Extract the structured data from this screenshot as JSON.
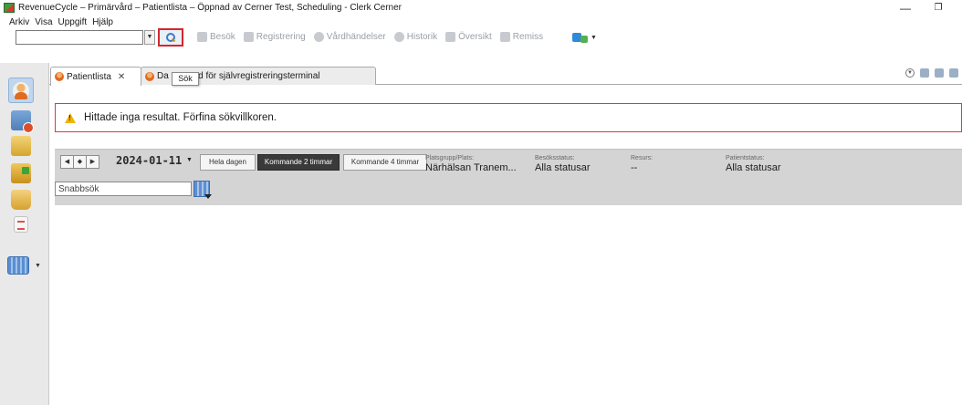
{
  "window": {
    "title": "RevenueCycle – Primärvård – Patientlista – Öppnad av Cerner Test, Scheduling - Clerk Cerner",
    "minimize_glyph": "—",
    "maximize_glyph": "❐"
  },
  "menu": [
    "Arkiv",
    "Visa",
    "Uppgift",
    "Hjälp"
  ],
  "toolbar": {
    "search_value": "",
    "search_tooltip": "Sök",
    "items": [
      {
        "label": "Besök",
        "icon": "visit-icon"
      },
      {
        "label": "Registrering",
        "icon": "registration-icon"
      },
      {
        "label": "Vårdhändelser",
        "icon": "care-events-icon"
      },
      {
        "label": "Historik",
        "icon": "history-icon"
      },
      {
        "label": "Översikt",
        "icon": "overview-icon"
      },
      {
        "label": "Remiss",
        "icon": "referral-icon"
      }
    ]
  },
  "sidebar": {
    "items": [
      {
        "name": "patient-list",
        "icon": "patient-icon"
      },
      {
        "name": "schedule",
        "icon": "calendar-clock-icon"
      },
      {
        "name": "documents",
        "icon": "document-icon"
      },
      {
        "name": "transfer",
        "icon": "folder-transfer-icon"
      },
      {
        "name": "messages",
        "icon": "envelope-icon"
      },
      {
        "name": "notes",
        "icon": "note-icon"
      },
      {
        "name": "organization",
        "icon": "building-icon"
      }
    ]
  },
  "tabs": [
    {
      "label": "Patientlista",
      "close": "✕",
      "active": true
    },
    {
      "label": "Da",
      "label_after_tooltip": "rd för självregistreringsterminal",
      "active": false
    }
  ],
  "alert": {
    "message": "Hittade inga resultat. Förfina sökvillkoren.",
    "border_color": "#d93a40"
  },
  "schedule": {
    "date": "2024-01-11",
    "range_options": [
      "Hela dagen",
      "Kommande 2 timmar",
      "Kommande 4 timmar"
    ],
    "selected_range": "Kommande 2 timmar",
    "filters": [
      {
        "label": "Platsgrupp/Plats:",
        "value": "Närhälsan Tranem..."
      },
      {
        "label": "Besöksstatus:",
        "value": "Alla statusar"
      },
      {
        "label": "Resurs:",
        "value": "--"
      },
      {
        "label": "Patientstatus:",
        "value": "Alla statusar"
      }
    ],
    "quick_search_placeholder": "Snabbsök"
  }
}
